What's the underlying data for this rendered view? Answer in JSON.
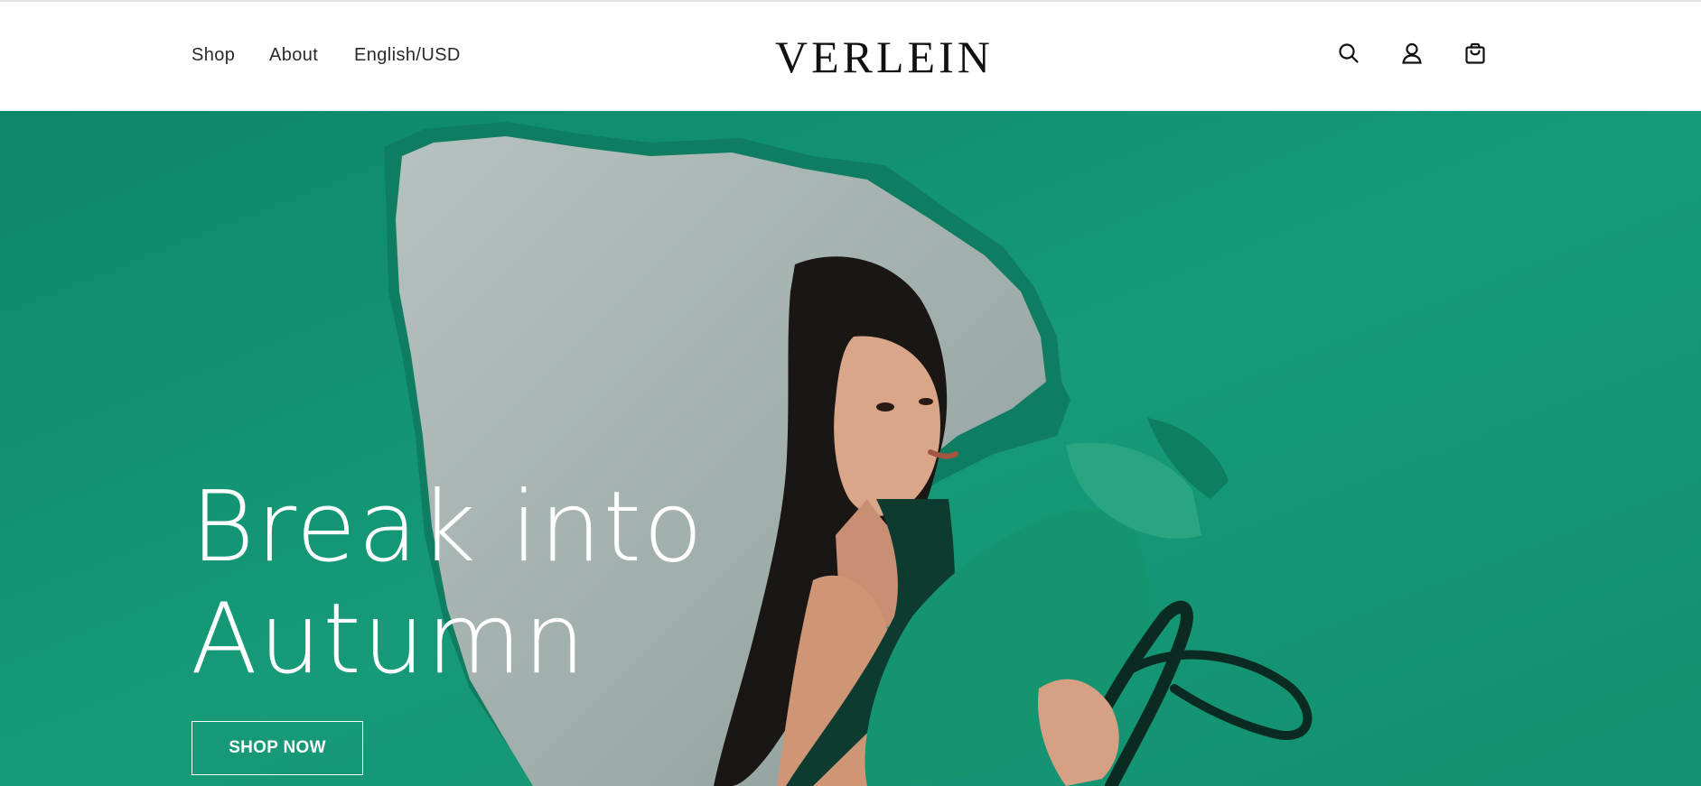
{
  "header": {
    "nav": [
      {
        "label": "Shop"
      },
      {
        "label": "About"
      },
      {
        "label": "English/USD"
      }
    ],
    "logo": "VERLEIN",
    "icons": [
      "search-icon",
      "account-icon",
      "cart-icon"
    ]
  },
  "hero": {
    "headline_line1": "Break into",
    "headline_line2": "Autumn",
    "cta_label": "SHOP NOW",
    "colors": {
      "background": "#139272",
      "cutout": "#a2afad",
      "text": "#ffffff"
    }
  }
}
